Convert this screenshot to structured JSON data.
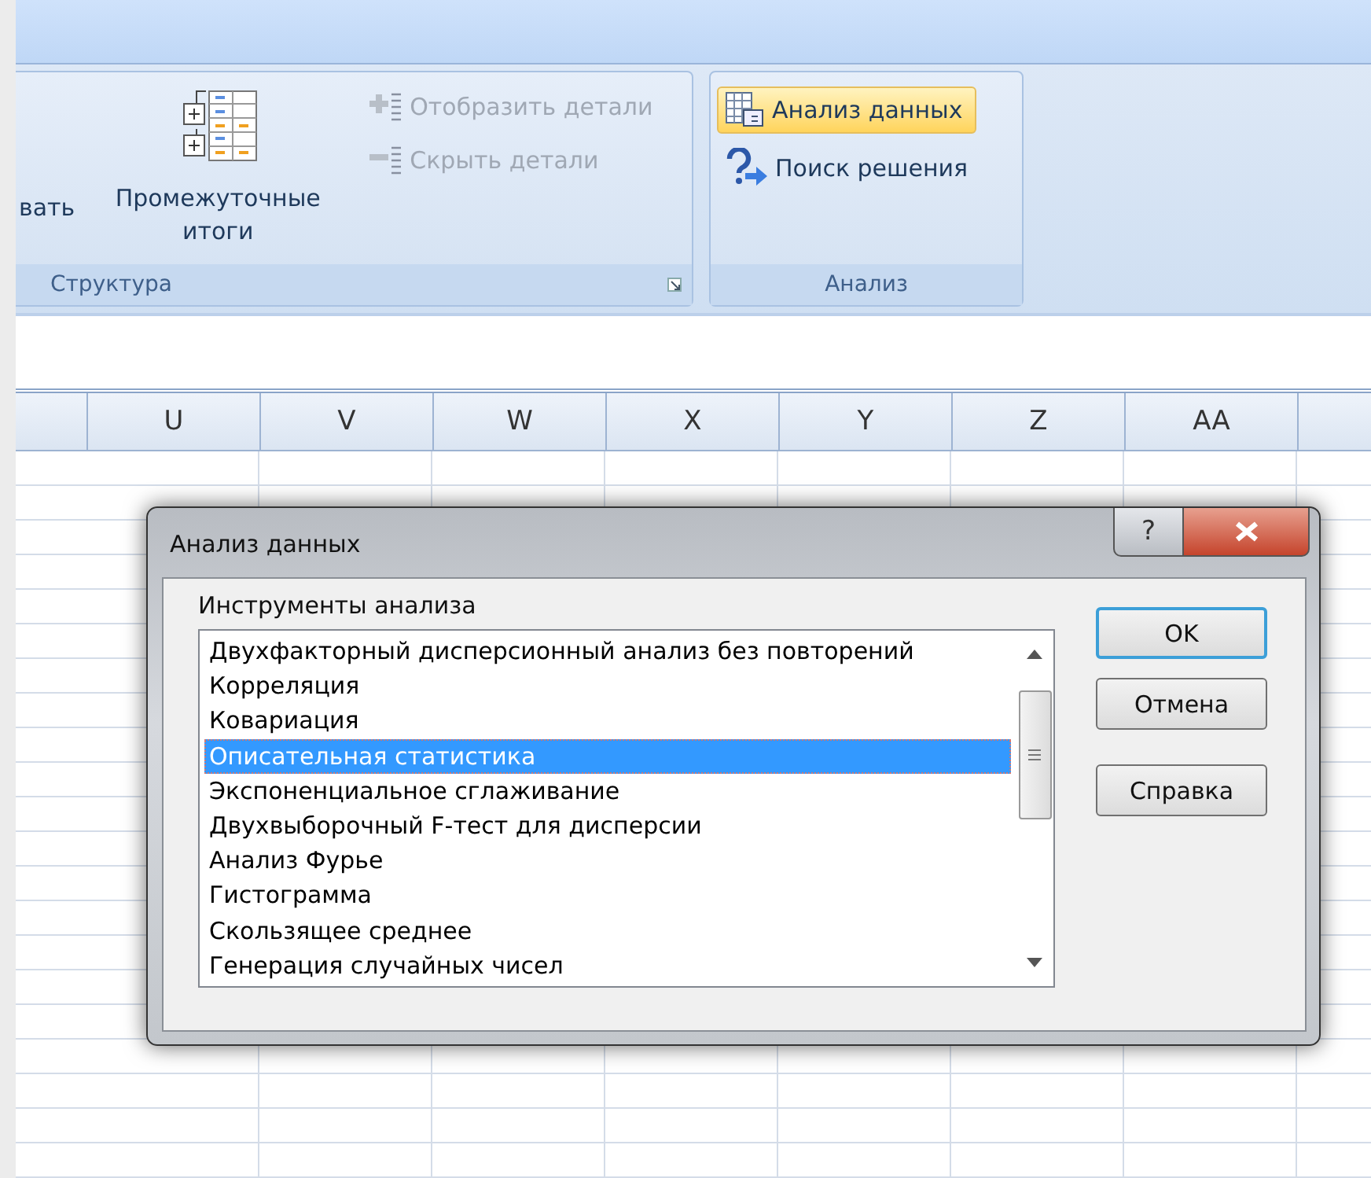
{
  "ribbon": {
    "groups": [
      {
        "label": "Структура",
        "large_buttons": [
          {
            "label": "вать",
            "kind": "cut"
          },
          {
            "label": "Промежуточные итоги",
            "kind": "subtotal"
          }
        ],
        "small_buttons": [
          {
            "label": "Отобразить детали",
            "kind": "expand",
            "disabled": true,
            "highlighted": false
          },
          {
            "label": "Скрыть детали",
            "kind": "collapse",
            "disabled": true,
            "highlighted": false
          }
        ]
      },
      {
        "label": "Анализ",
        "small_buttons": [
          {
            "label": "Анализ данных",
            "kind": "table",
            "disabled": false,
            "highlighted": true
          },
          {
            "label": "Поиск решения",
            "kind": "solver",
            "disabled": false,
            "highlighted": false
          }
        ]
      }
    ]
  },
  "sheet": {
    "columns": [
      "U",
      "V",
      "W",
      "X",
      "Y",
      "Z",
      "AA"
    ]
  },
  "dialog": {
    "title": "Анализ данных",
    "help_button": "?",
    "group_label": "Инструменты анализа",
    "items": [
      {
        "label": "Двухфакторный дисперсионный анализ без повторений",
        "selected": false
      },
      {
        "label": "Корреляция",
        "selected": false
      },
      {
        "label": "Ковариация",
        "selected": false
      },
      {
        "label": "Описательная статистика",
        "selected": true
      },
      {
        "label": "Экспоненциальное сглаживание",
        "selected": false
      },
      {
        "label": "Двухвыборочный F-тест для дисперсии",
        "selected": false
      },
      {
        "label": "Анализ Фурье",
        "selected": false
      },
      {
        "label": "Гистограмма",
        "selected": false
      },
      {
        "label": "Скользящее среднее",
        "selected": false
      },
      {
        "label": "Генерация случайных чисел",
        "selected": false
      }
    ],
    "buttons": [
      {
        "label": "OK",
        "default": true
      },
      {
        "label": "Отмена",
        "default": false
      },
      {
        "label": "Справка",
        "default": false
      }
    ]
  }
}
